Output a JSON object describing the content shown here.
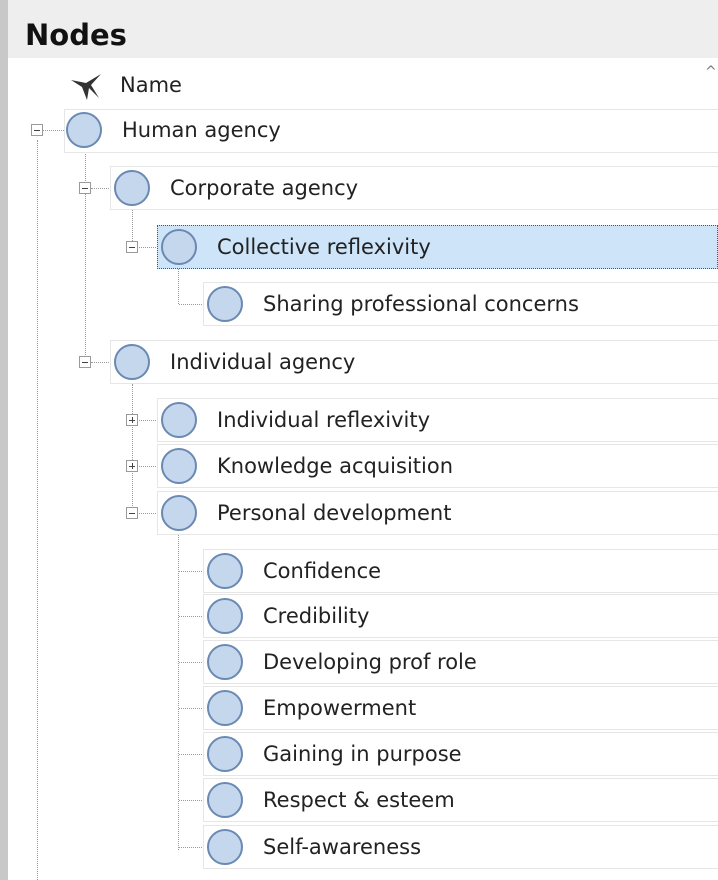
{
  "pane": {
    "title": "Nodes",
    "column_name_label": "Name",
    "sort_arrow": "^"
  },
  "icons": {
    "sort_header_icon": "pin-icon",
    "node_icon": "node-circle-icon",
    "expanded_toggle": "minus-box-icon",
    "collapsed_toggle": "plus-box-icon"
  },
  "colors": {
    "selection_bg": "#cde4f9",
    "node_fill": "#c5d7ec",
    "node_stroke": "#6a89b3"
  },
  "tree": {
    "human_agency": "Human agency",
    "corporate_agency": "Corporate agency",
    "collective_reflexivity": "Collective reflexivity",
    "sharing_professional_concerns": "Sharing professional concerns",
    "individual_agency": "Individual agency",
    "individual_reflexivity": "Individual reflexivity",
    "knowledge_acquisition": "Knowledge acquisition",
    "personal_development": "Personal development",
    "confidence": "Confidence",
    "credibility": "Credibility",
    "developing_prof_role": "Developing prof role",
    "empowerment": "Empowerment",
    "gaining_in_purpose": "Gaining in purpose",
    "respect_esteem": "Respect & esteem",
    "self_awareness": "Self-awareness"
  },
  "selected_node": "Collective reflexivity"
}
